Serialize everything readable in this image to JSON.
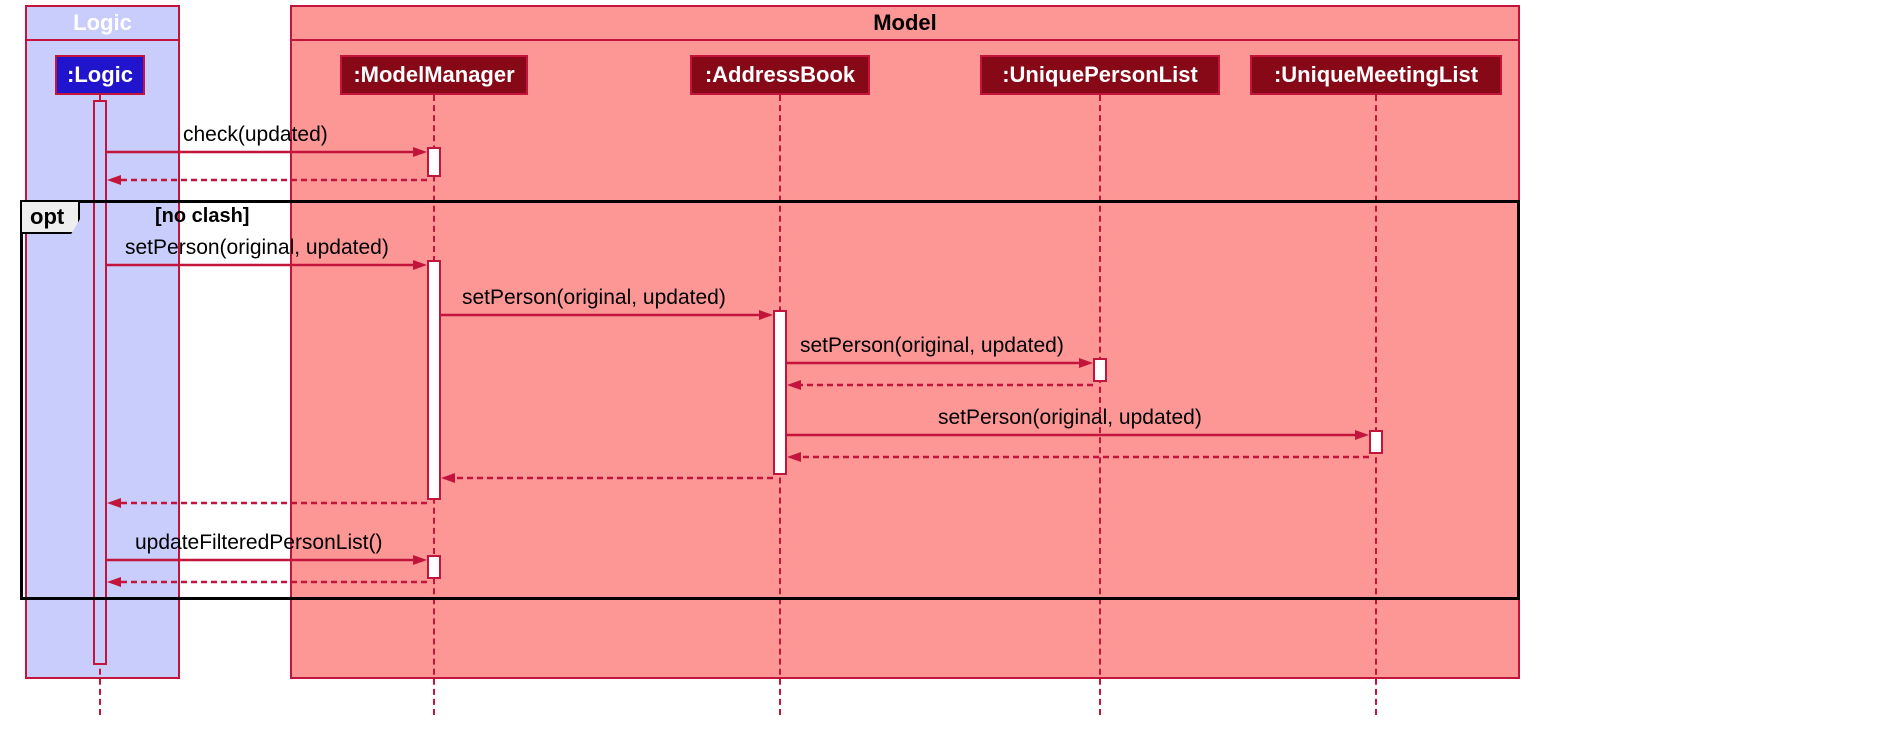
{
  "groups": {
    "logic": "Logic",
    "model": "Model"
  },
  "participants": {
    "logic": ":Logic",
    "modelManager": ":ModelManager",
    "addressBook": ":AddressBook",
    "uniquePersonList": ":UniquePersonList",
    "uniqueMeetingList": ":UniqueMeetingList"
  },
  "messages": {
    "check": "check(updated)",
    "setPerson1": "setPerson(original, updated)",
    "setPerson2": "setPerson(original, updated)",
    "setPerson3": "setPerson(original, updated)",
    "setPerson4": "setPerson(original, updated)",
    "updateFilteredPersonList": "updateFilteredPersonList()"
  },
  "fragment": {
    "type": "opt",
    "guard": "[no clash]"
  }
}
